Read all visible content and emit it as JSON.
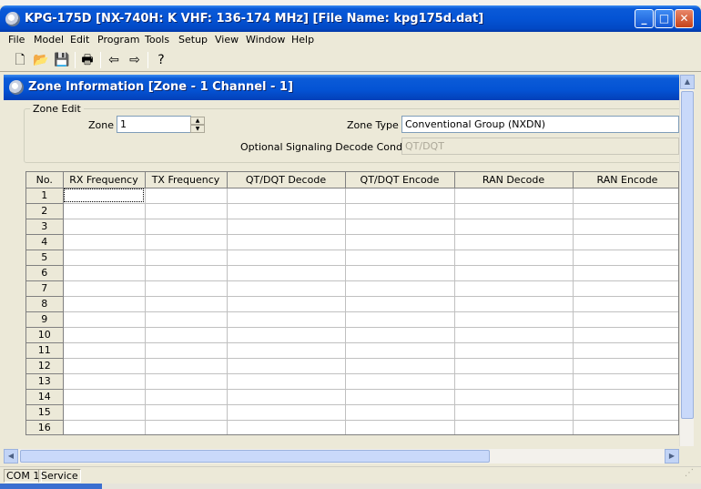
{
  "window": {
    "title": "KPG-175D [NX-740H: K VHF: 136-174 MHz] [File Name: kpg175d.dat]",
    "buttons": {
      "minimize": "_",
      "maximize": "□",
      "close": "✕"
    }
  },
  "menubar": {
    "items": [
      "File",
      "Model",
      "Edit",
      "Program",
      "Tools",
      "Setup",
      "View",
      "Window",
      "Help"
    ]
  },
  "toolbar": {
    "icons": [
      "new-file-icon",
      "open-folder-icon",
      "save-disk-icon",
      "print-icon",
      "read-radio-icon",
      "write-radio-icon",
      "help-icon"
    ]
  },
  "child_window": {
    "title": "Zone Information [Zone - 1   Channel  -  1]"
  },
  "zone_edit": {
    "group_label": "Zone Edit",
    "zone_label": "Zone",
    "zone_value": "1",
    "zone_type_label": "Zone Type",
    "zone_type_value": "Conventional Group (NXDN)",
    "optional_label": "Optional Signaling Decode Condition",
    "optional_value": "QT/DQT"
  },
  "grid": {
    "columns": [
      "No.",
      "RX Frequency",
      "TX Frequency",
      "QT/DQT Decode",
      "QT/DQT Encode",
      "RAN Decode",
      "RAN Encode"
    ],
    "rows": [
      "1",
      "2",
      "3",
      "4",
      "5",
      "6",
      "7",
      "8",
      "9",
      "10",
      "11",
      "12",
      "13",
      "14",
      "15",
      "16"
    ]
  },
  "statusbar": {
    "port": "COM 1",
    "mode": "Service"
  }
}
